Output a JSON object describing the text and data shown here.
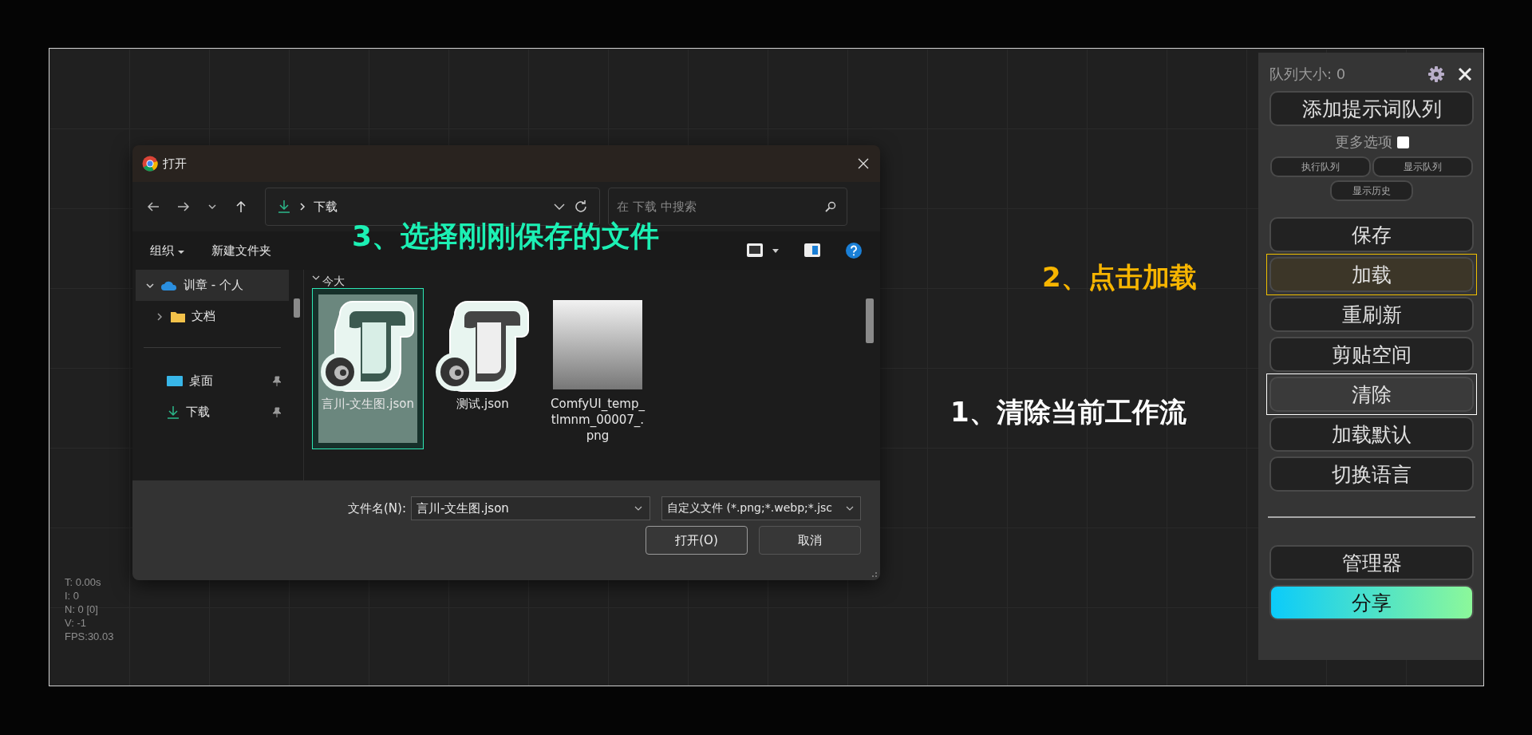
{
  "dialog": {
    "title": "打开",
    "path": "下载",
    "search": {
      "placeholder": "在 下载 中搜索"
    },
    "toolbar": {
      "organize": "组织",
      "new_folder": "新建文件夹"
    },
    "tree": [
      {
        "label": "训章 - 个人",
        "kind": "cloud",
        "expanded": true,
        "selected": true,
        "children": [
          {
            "label": "文档",
            "kind": "folder",
            "expanded": false
          }
        ]
      }
    ],
    "quick_access": [
      {
        "label": "桌面",
        "kind": "desktop",
        "pinned": true
      },
      {
        "label": "下载",
        "kind": "download",
        "pinned": true
      }
    ],
    "group_label": "今大",
    "files": [
      {
        "name": "言川-文生图.json",
        "kind": "json",
        "selected": true
      },
      {
        "name": "测试.json",
        "kind": "json",
        "selected": false
      },
      {
        "name": "ComfyUI_temp_tlmnm_00007_.png",
        "kind": "image",
        "selected": false
      }
    ],
    "filename": {
      "label": "文件名(N):",
      "value": "言川-文生图.json"
    },
    "filetype": "自定义文件 (*.png;*.webp;*.jsc",
    "buttons": [
      "打开(O)",
      "取消"
    ]
  },
  "panel": {
    "queue_label": "队列大小: 0",
    "add_queue": "添加提示词队列",
    "more_options": {
      "label": "更多选项",
      "checked": false
    },
    "small_buttons": [
      "执行队列",
      "显示队列",
      "显示历史"
    ],
    "buttons": [
      {
        "label": "保存"
      },
      {
        "label": "加载",
        "color": "#f0c000"
      },
      {
        "label": "重刷新"
      },
      {
        "label": "剪贴空间"
      },
      {
        "label": "清除",
        "color": "#ffffff"
      },
      {
        "label": "加载默认"
      },
      {
        "label": "切换语言"
      }
    ],
    "manager": "管理器",
    "share": "分享"
  },
  "stats": [
    "T: 0.00s",
    "I: 0",
    "N: 0 [0]",
    "V: -1",
    "FPS:30.03"
  ],
  "annotations": [
    {
      "text": "3、选择刚刚保存的文件",
      "color": "#1cf0b4"
    },
    {
      "text": "2、点击加载",
      "color": "#f7b500"
    },
    {
      "text": "1、清除当前工作流",
      "color": "#ffffff"
    }
  ]
}
